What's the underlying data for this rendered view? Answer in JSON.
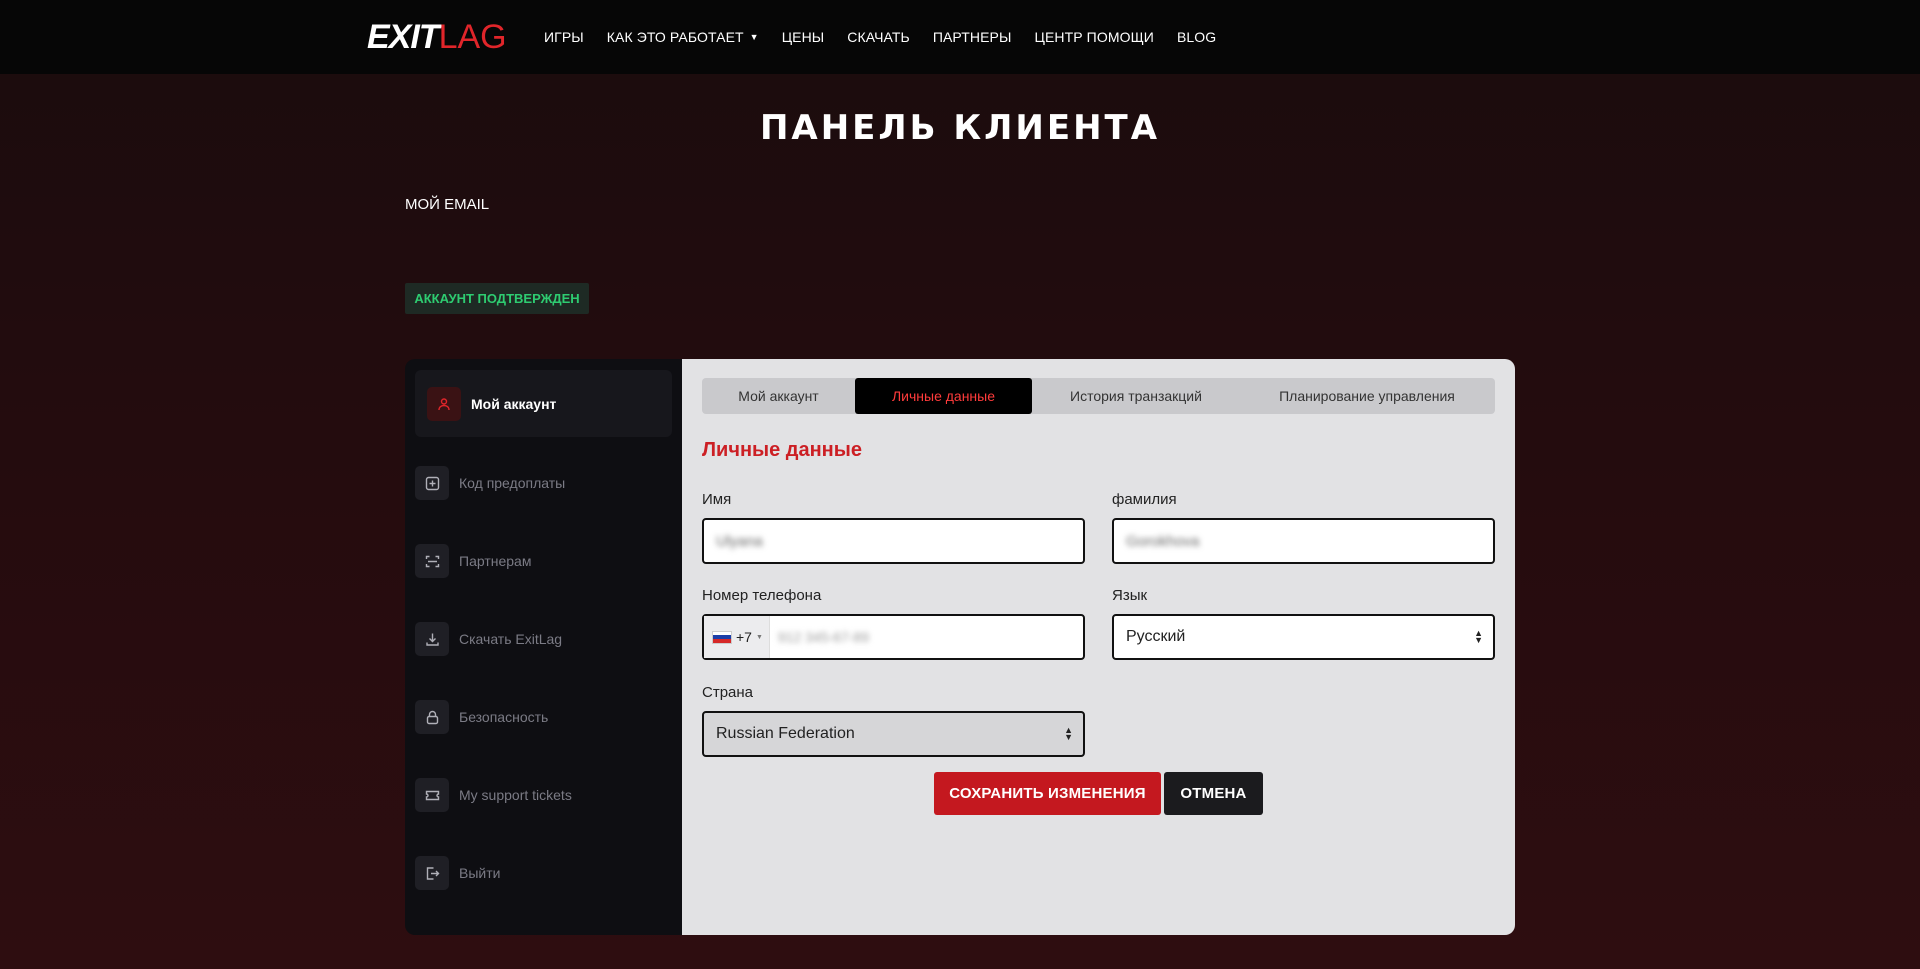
{
  "nav": {
    "logo_exit": "EXIT",
    "logo_lag": "LAG",
    "links": [
      "ИГРЫ",
      "КАК ЭТО РАБОТАЕТ",
      "ЦЕНЫ",
      "СКАЧАТЬ",
      "ПАРТНЕРЫ",
      "ЦЕНТР ПОМОЩИ",
      "BLOG"
    ]
  },
  "header": {
    "title": "ПАНЕЛЬ КЛИЕНТА",
    "email_label": "МОЙ EMAIL",
    "verified_badge": "АККАУНТ ПОДТВЕРЖДЕН"
  },
  "sidebar": {
    "active_item": "Мой аккаунт",
    "items": [
      "Код предоплаты",
      "Партнерам",
      "Скачать ExitLag",
      "Безопасность",
      "My support tickets",
      "Выйти"
    ]
  },
  "tabs": [
    "Мой аккаунт",
    "Личные данные",
    "История транзакций",
    "Планирование управления"
  ],
  "active_tab": "Личные данные",
  "form": {
    "section_title": "Личные данные",
    "first_name_label": "Имя",
    "first_name_value": "Ulyana",
    "last_name_label": "фамилия",
    "last_name_value": "Gorokhova",
    "phone_label": "Номер телефона",
    "phone_code": "+7",
    "phone_placeholder": "912 345-67-89",
    "language_label": "Язык",
    "language_value": "Русский",
    "country_label": "Страна",
    "country_value": "Russian Federation",
    "save_button": "СОХРАНИТЬ ИЗМЕНЕНИЯ",
    "cancel_button": "ОТМЕНА"
  },
  "colors": {
    "accent": "#c4181f",
    "success": "#2ecc71",
    "nav_bg": "#060606"
  }
}
